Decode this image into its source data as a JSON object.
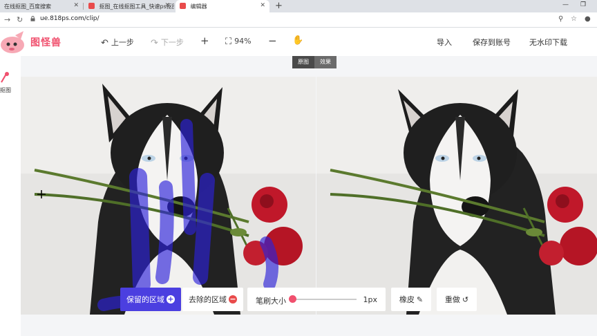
{
  "browser": {
    "tabs": [
      {
        "title": "在线抠图_百度搜索",
        "active": false
      },
      {
        "title": "抠图_在线抠图工具_快速ps抠图",
        "active": false
      },
      {
        "title": "编辑器",
        "active": true
      }
    ],
    "url": "ue.818ps.com/clip/"
  },
  "header": {
    "logo_text": "图怪兽",
    "undo_label": "上一步",
    "redo_label": "下一步",
    "zoom": "94%",
    "import_label": "导入",
    "save_label": "保存到账号",
    "download_label": "无水印下载"
  },
  "sidebar": {
    "item_label": "抠图"
  },
  "view_toggle": {
    "original": "原图",
    "result": "效果"
  },
  "toolbar": {
    "keep_label": "保留的区域",
    "remove_label": "去除的区域",
    "brush_label": "笔刷大小",
    "brush_value": "1px",
    "brush_level": 0.0,
    "eraser_label": "橡皮",
    "redo_label": "重做"
  },
  "colors": {
    "accent": "#4b3fe0",
    "brand": "#f0506e",
    "remove": "#e94b4b"
  }
}
